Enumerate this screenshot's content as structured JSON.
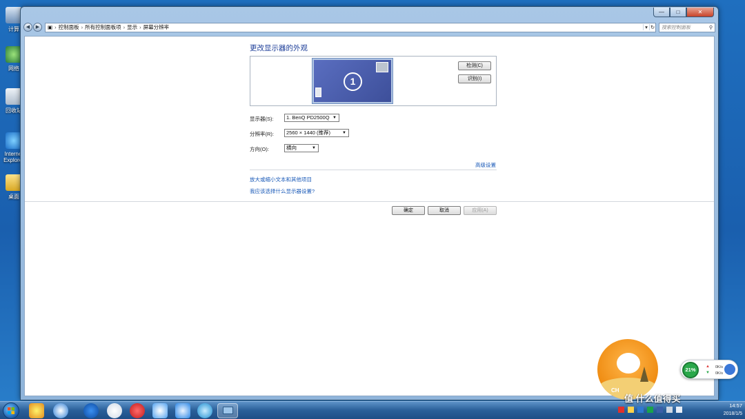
{
  "desktop": {
    "icons": [
      {
        "label": "计算"
      },
      {
        "label": "网络"
      },
      {
        "label": "回收站"
      },
      {
        "label": "Internet Explorer"
      },
      {
        "label": "桌面"
      }
    ]
  },
  "window": {
    "caption": {
      "minimize": "—",
      "maximize": "□",
      "close": "✕"
    },
    "breadcrumb": [
      "控制面板",
      "所有控制面板项",
      "显示",
      "屏幕分辨率"
    ],
    "search_placeholder": "搜索控制面板"
  },
  "display": {
    "title": "更改显示器的外观",
    "monitor_number": "1",
    "detect_button": "检测(C)",
    "identify_button": "识别(I)",
    "display_label": "显示器(S):",
    "display_value": "1. BenQ PD2500Q",
    "resolution_label": "分辨率(R):",
    "resolution_value": "2560 × 1440 (推荐)",
    "orientation_label": "方向(O):",
    "orientation_value": "横向",
    "advanced_link": "高级设置",
    "text_size_link": "放大或缩小文本和其他项目",
    "help_link": "我应该选择什么显示器设置?",
    "ok_button": "确定",
    "cancel_button": "取消",
    "apply_button": "应用(A)"
  },
  "widgets": {
    "mascot_text": "CH",
    "speed_percent": "21%",
    "upload_rate": "0K/s",
    "download_rate": "0K/s",
    "watermark": "值 什么值得买"
  },
  "taskbar": {
    "time": "14:57",
    "date": "2018/1/5"
  },
  "colors": {
    "desktop": "#1a5fae",
    "title_text": "#1e3f99",
    "link": "#1a5ab8",
    "monitor_fill": "#4a5daf",
    "speed_ring": "#2aa84b",
    "mascot": "#ef8c12"
  }
}
